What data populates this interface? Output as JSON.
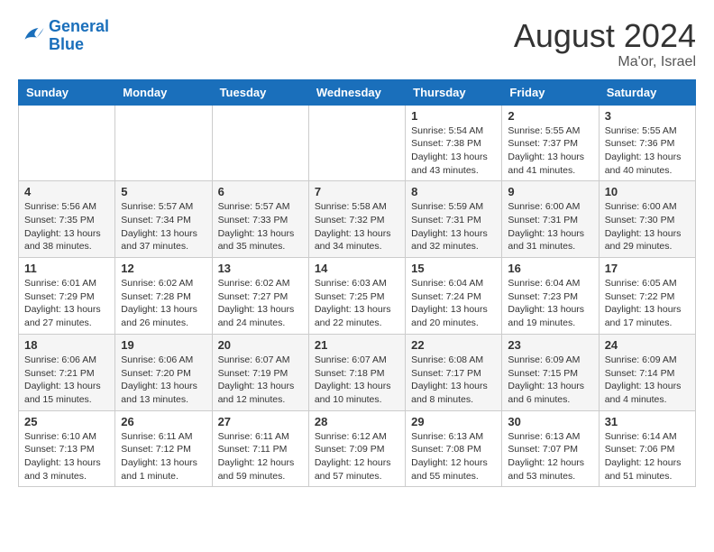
{
  "header": {
    "logo_line1": "General",
    "logo_line2": "Blue",
    "month_year": "August 2024",
    "location": "Ma'or, Israel"
  },
  "days_of_week": [
    "Sunday",
    "Monday",
    "Tuesday",
    "Wednesday",
    "Thursday",
    "Friday",
    "Saturday"
  ],
  "weeks": [
    [
      {
        "day": "",
        "info": ""
      },
      {
        "day": "",
        "info": ""
      },
      {
        "day": "",
        "info": ""
      },
      {
        "day": "",
        "info": ""
      },
      {
        "day": "1",
        "info": "Sunrise: 5:54 AM\nSunset: 7:38 PM\nDaylight: 13 hours\nand 43 minutes."
      },
      {
        "day": "2",
        "info": "Sunrise: 5:55 AM\nSunset: 7:37 PM\nDaylight: 13 hours\nand 41 minutes."
      },
      {
        "day": "3",
        "info": "Sunrise: 5:55 AM\nSunset: 7:36 PM\nDaylight: 13 hours\nand 40 minutes."
      }
    ],
    [
      {
        "day": "4",
        "info": "Sunrise: 5:56 AM\nSunset: 7:35 PM\nDaylight: 13 hours\nand 38 minutes."
      },
      {
        "day": "5",
        "info": "Sunrise: 5:57 AM\nSunset: 7:34 PM\nDaylight: 13 hours\nand 37 minutes."
      },
      {
        "day": "6",
        "info": "Sunrise: 5:57 AM\nSunset: 7:33 PM\nDaylight: 13 hours\nand 35 minutes."
      },
      {
        "day": "7",
        "info": "Sunrise: 5:58 AM\nSunset: 7:32 PM\nDaylight: 13 hours\nand 34 minutes."
      },
      {
        "day": "8",
        "info": "Sunrise: 5:59 AM\nSunset: 7:31 PM\nDaylight: 13 hours\nand 32 minutes."
      },
      {
        "day": "9",
        "info": "Sunrise: 6:00 AM\nSunset: 7:31 PM\nDaylight: 13 hours\nand 31 minutes."
      },
      {
        "day": "10",
        "info": "Sunrise: 6:00 AM\nSunset: 7:30 PM\nDaylight: 13 hours\nand 29 minutes."
      }
    ],
    [
      {
        "day": "11",
        "info": "Sunrise: 6:01 AM\nSunset: 7:29 PM\nDaylight: 13 hours\nand 27 minutes."
      },
      {
        "day": "12",
        "info": "Sunrise: 6:02 AM\nSunset: 7:28 PM\nDaylight: 13 hours\nand 26 minutes."
      },
      {
        "day": "13",
        "info": "Sunrise: 6:02 AM\nSunset: 7:27 PM\nDaylight: 13 hours\nand 24 minutes."
      },
      {
        "day": "14",
        "info": "Sunrise: 6:03 AM\nSunset: 7:25 PM\nDaylight: 13 hours\nand 22 minutes."
      },
      {
        "day": "15",
        "info": "Sunrise: 6:04 AM\nSunset: 7:24 PM\nDaylight: 13 hours\nand 20 minutes."
      },
      {
        "day": "16",
        "info": "Sunrise: 6:04 AM\nSunset: 7:23 PM\nDaylight: 13 hours\nand 19 minutes."
      },
      {
        "day": "17",
        "info": "Sunrise: 6:05 AM\nSunset: 7:22 PM\nDaylight: 13 hours\nand 17 minutes."
      }
    ],
    [
      {
        "day": "18",
        "info": "Sunrise: 6:06 AM\nSunset: 7:21 PM\nDaylight: 13 hours\nand 15 minutes."
      },
      {
        "day": "19",
        "info": "Sunrise: 6:06 AM\nSunset: 7:20 PM\nDaylight: 13 hours\nand 13 minutes."
      },
      {
        "day": "20",
        "info": "Sunrise: 6:07 AM\nSunset: 7:19 PM\nDaylight: 13 hours\nand 12 minutes."
      },
      {
        "day": "21",
        "info": "Sunrise: 6:07 AM\nSunset: 7:18 PM\nDaylight: 13 hours\nand 10 minutes."
      },
      {
        "day": "22",
        "info": "Sunrise: 6:08 AM\nSunset: 7:17 PM\nDaylight: 13 hours\nand 8 minutes."
      },
      {
        "day": "23",
        "info": "Sunrise: 6:09 AM\nSunset: 7:15 PM\nDaylight: 13 hours\nand 6 minutes."
      },
      {
        "day": "24",
        "info": "Sunrise: 6:09 AM\nSunset: 7:14 PM\nDaylight: 13 hours\nand 4 minutes."
      }
    ],
    [
      {
        "day": "25",
        "info": "Sunrise: 6:10 AM\nSunset: 7:13 PM\nDaylight: 13 hours\nand 3 minutes."
      },
      {
        "day": "26",
        "info": "Sunrise: 6:11 AM\nSunset: 7:12 PM\nDaylight: 13 hours\nand 1 minute."
      },
      {
        "day": "27",
        "info": "Sunrise: 6:11 AM\nSunset: 7:11 PM\nDaylight: 12 hours\nand 59 minutes."
      },
      {
        "day": "28",
        "info": "Sunrise: 6:12 AM\nSunset: 7:09 PM\nDaylight: 12 hours\nand 57 minutes."
      },
      {
        "day": "29",
        "info": "Sunrise: 6:13 AM\nSunset: 7:08 PM\nDaylight: 12 hours\nand 55 minutes."
      },
      {
        "day": "30",
        "info": "Sunrise: 6:13 AM\nSunset: 7:07 PM\nDaylight: 12 hours\nand 53 minutes."
      },
      {
        "day": "31",
        "info": "Sunrise: 6:14 AM\nSunset: 7:06 PM\nDaylight: 12 hours\nand 51 minutes."
      }
    ]
  ]
}
